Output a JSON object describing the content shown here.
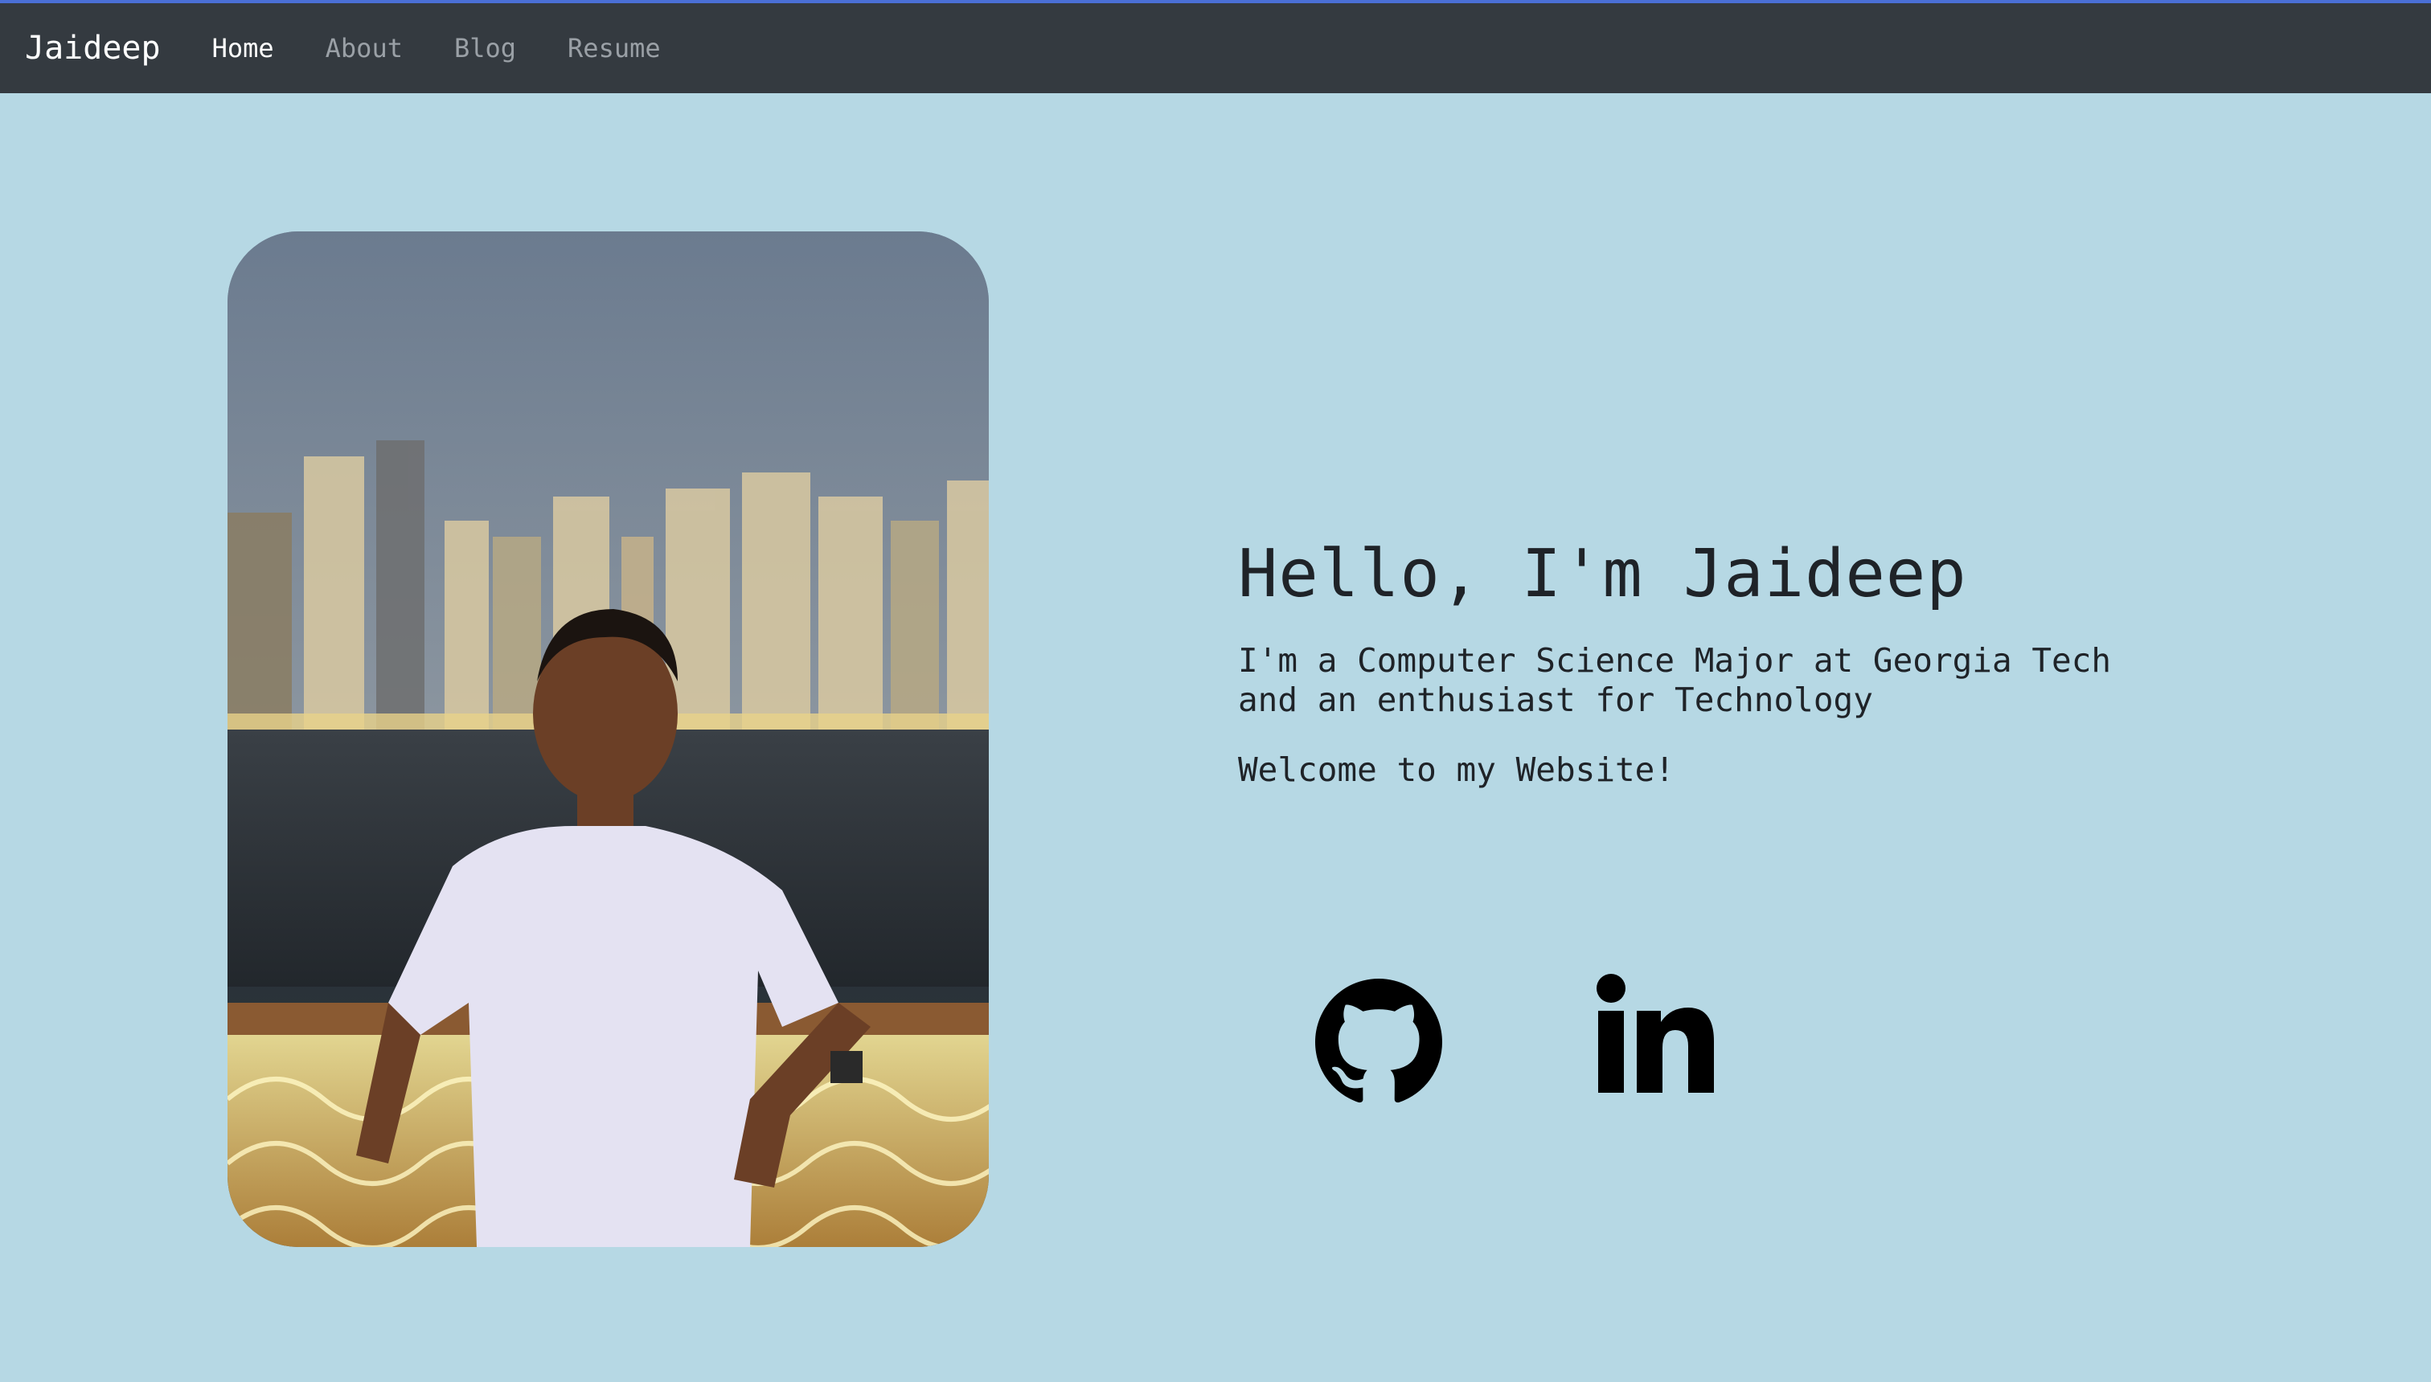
{
  "navbar": {
    "brand": "Jaideep",
    "links": [
      {
        "label": "Home",
        "active": true
      },
      {
        "label": "About",
        "active": false
      },
      {
        "label": "Blog",
        "active": false
      },
      {
        "label": "Resume",
        "active": false
      }
    ]
  },
  "hero": {
    "heading": "Hello, I'm Jaideep",
    "intro": "I'm a Computer Science Major at Georgia Tech and an enthusiast for Technology",
    "welcome": "Welcome to my Website!"
  },
  "social": {
    "icons": [
      "github-icon",
      "linkedin-icon"
    ]
  },
  "colors": {
    "background": "#b6d8e4",
    "navbar": "#343a40",
    "accent_line": "#4a6fd6"
  }
}
